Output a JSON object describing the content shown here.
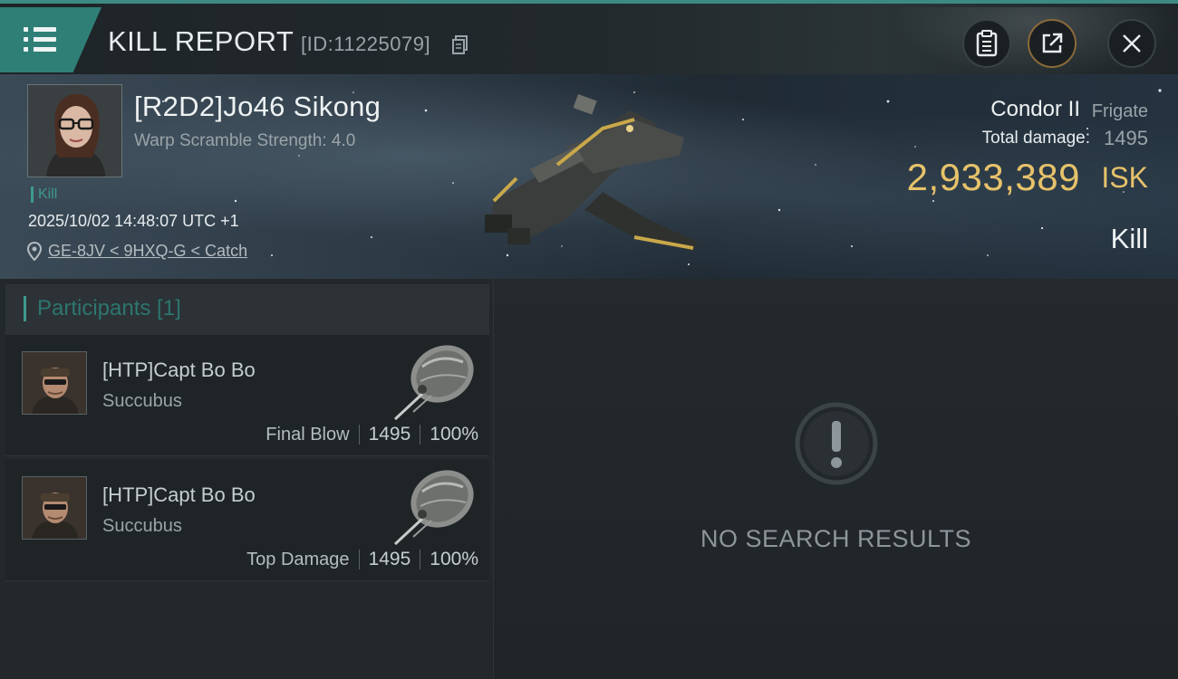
{
  "header": {
    "title": "KILL REPORT",
    "kill_id": "[ID:11225079]"
  },
  "victim": {
    "name": "[R2D2]Jo46 Sikong",
    "warp_scramble": "Warp Scramble Strength: 4.0",
    "tag": "Kill",
    "timestamp": "2025/10/02 14:48:07 UTC +1",
    "location": "GE-8JV < 9HXQ-G < Catch",
    "ship_name": "Condor II",
    "ship_class": "Frigate",
    "total_damage_label": "Total damage:",
    "total_damage": "1495",
    "isk_value": "2,933,389",
    "isk_unit": "ISK",
    "result": "Kill"
  },
  "participants": {
    "title": "Participants [1]",
    "rows": [
      {
        "name": "[HTP]Capt Bo Bo",
        "ship": "Succubus",
        "tag": "Final Blow",
        "damage": "1495",
        "percent": "100%"
      },
      {
        "name": "[HTP]Capt Bo Bo",
        "ship": "Succubus",
        "tag": "Top Damage",
        "damage": "1495",
        "percent": "100%"
      }
    ]
  },
  "results": {
    "empty_text": "NO SEARCH RESULTS"
  },
  "icons": {
    "menu": "menu-icon",
    "copy": "copy-icon",
    "clipboard": "clipboard-icon",
    "share": "share-icon",
    "close": "close-icon",
    "pin": "location-pin-icon",
    "alert": "alert-icon"
  },
  "colors": {
    "accent": "#3d9a8e",
    "isk": "#e6c26a",
    "share_ring": "#8a6a3a"
  }
}
